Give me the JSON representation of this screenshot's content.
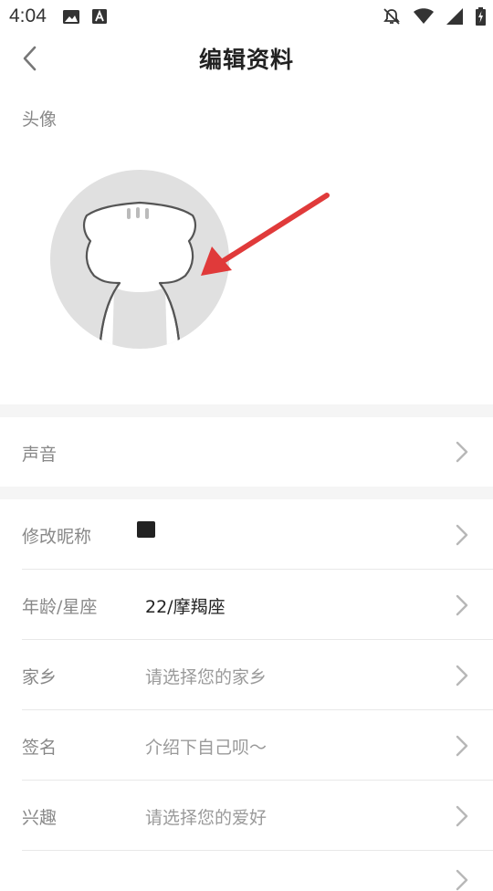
{
  "status_bar": {
    "time": "4:04",
    "left_icons": [
      "image-icon",
      "font-icon"
    ],
    "right_icons": [
      "bell-muted-icon",
      "wifi-icon",
      "signal-icon",
      "battery-charging-icon"
    ]
  },
  "header": {
    "title": "编辑资料",
    "back_icon": "chevron-left-icon"
  },
  "avatar": {
    "label": "头像",
    "image": "cat-silhouette-avatar",
    "annotation": "red-arrow-pointing-to-avatar"
  },
  "voice": {
    "label": "声音"
  },
  "profile_rows": [
    {
      "label": "修改昵称",
      "value": "",
      "value_type": "filled"
    },
    {
      "label": "年龄/星座",
      "value": "22/摩羯座",
      "value_type": "filled"
    },
    {
      "label": "家乡",
      "value": "请选择您的家乡",
      "value_type": "placeholder"
    },
    {
      "label": "签名",
      "value": "介绍下自己呗～",
      "value_type": "placeholder"
    },
    {
      "label": "兴趣",
      "value": "请选择您的爱好",
      "value_type": "placeholder"
    }
  ],
  "colors": {
    "arrow": "#e03a3a",
    "label": "#888888",
    "placeholder": "#9a9a9a",
    "section_gap": "#f5f5f5",
    "avatar_bg": "#e0e0e0"
  }
}
